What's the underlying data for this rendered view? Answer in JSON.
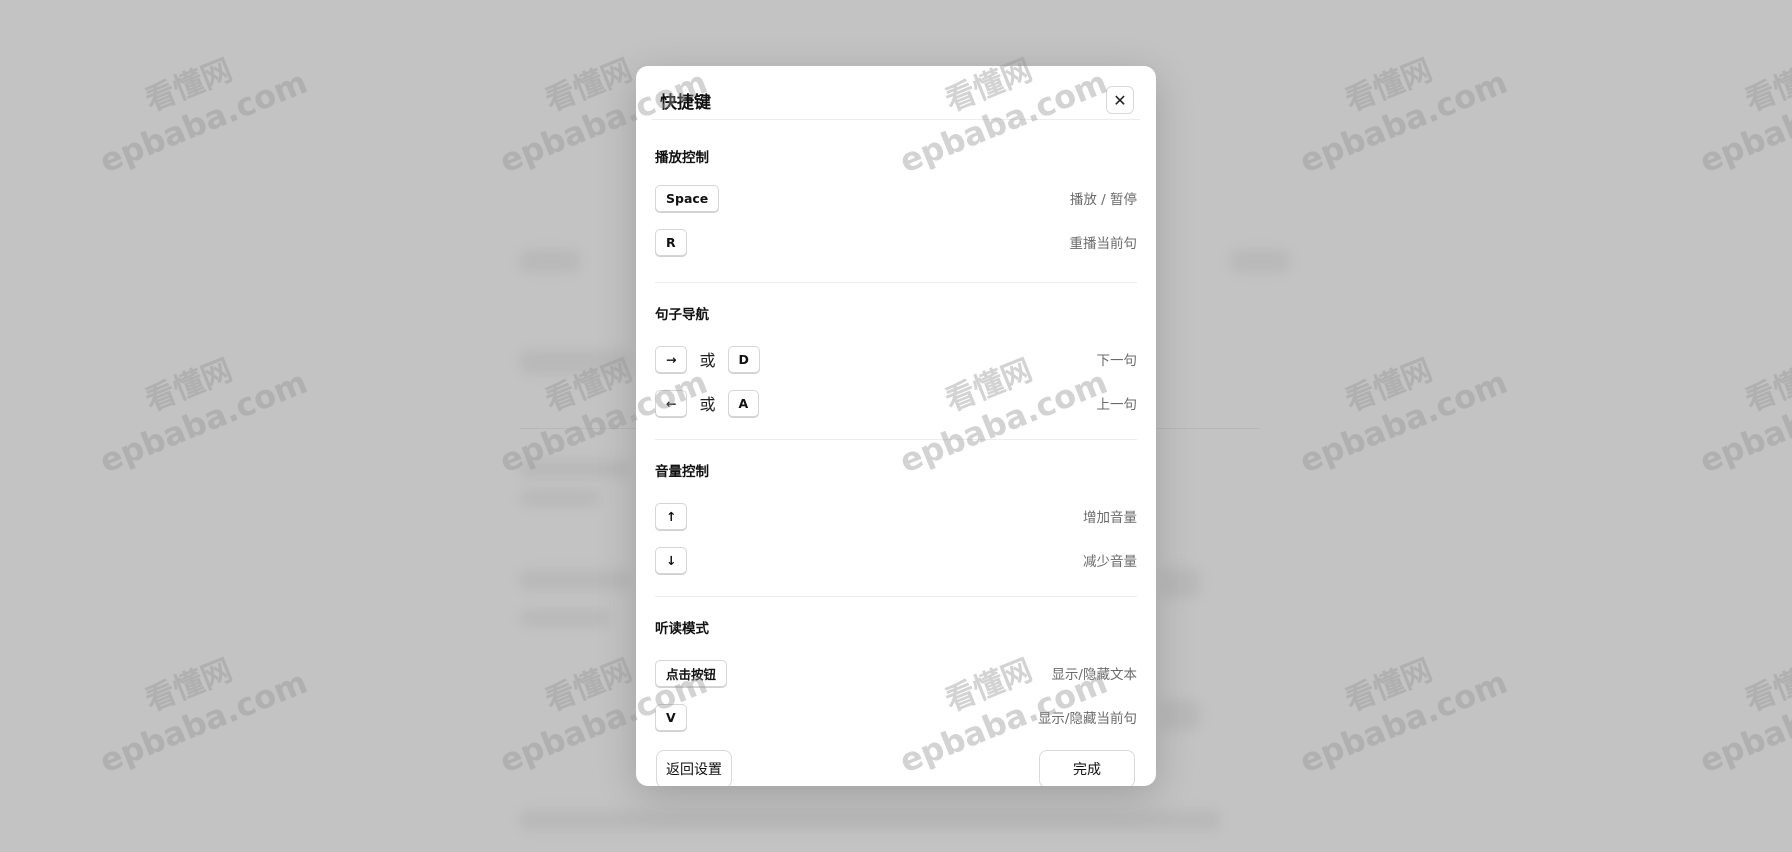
{
  "modal": {
    "title": "快捷键",
    "close_icon": "close-icon",
    "sections": [
      {
        "title": "播放控制",
        "rows": [
          {
            "keys": [
              "Space"
            ],
            "description": "播放 / 暂停"
          },
          {
            "keys": [
              "R"
            ],
            "description": "重播当前句"
          }
        ]
      },
      {
        "title": "句子导航",
        "rows": [
          {
            "keys": [
              "→",
              "D"
            ],
            "separator": "或",
            "description": "下一句",
            "icon": "arrow-right-icon"
          },
          {
            "keys": [
              "←",
              "A"
            ],
            "separator": "或",
            "description": "上一句",
            "icon": "arrow-left-icon"
          }
        ]
      },
      {
        "title": "音量控制",
        "rows": [
          {
            "keys": [
              "↑"
            ],
            "description": "增加音量",
            "icon": "arrow-up-icon"
          },
          {
            "keys": [
              "↓"
            ],
            "description": "减少音量",
            "icon": "arrow-down-icon"
          }
        ]
      },
      {
        "title": "听读模式",
        "rows": [
          {
            "keys": [
              "点击按钮"
            ],
            "description": "显示/隐藏文本"
          },
          {
            "keys": [
              "V"
            ],
            "description": "显示/隐藏当前句"
          }
        ]
      }
    ],
    "footer": {
      "back_label": "返回设置",
      "done_label": "完成"
    }
  },
  "watermark": {
    "line1": "看懂网",
    "line2": "epbaba.com"
  },
  "colors": {
    "overlay": "#c3c3c3",
    "modal_bg": "#ffffff",
    "muted_text": "#6b6b6b"
  }
}
